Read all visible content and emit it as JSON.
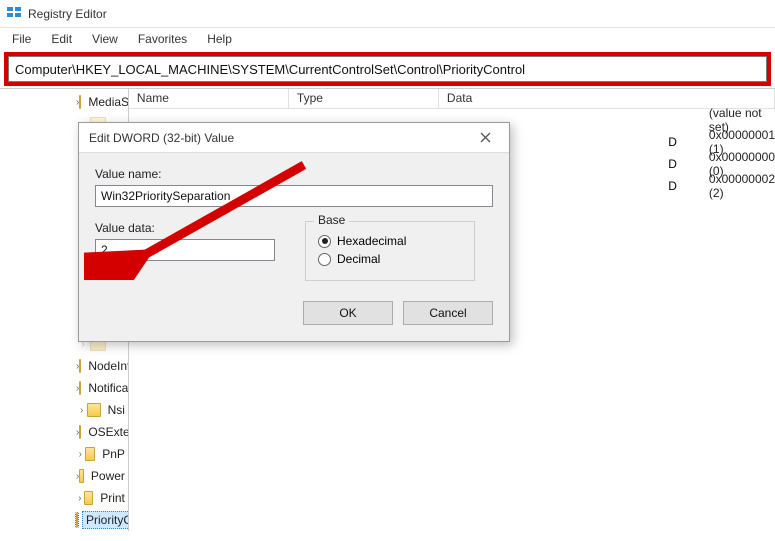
{
  "window": {
    "title": "Registry Editor"
  },
  "menu": {
    "file": "File",
    "edit": "Edit",
    "view": "View",
    "favorites": "Favorites",
    "help": "Help"
  },
  "address": {
    "value": "Computer\\HKEY_LOCAL_MACHINE\\SYSTEM\\CurrentControlSet\\Control\\PriorityControl"
  },
  "columns": {
    "name": "Name",
    "type": "Type",
    "data": "Data"
  },
  "values_list": {
    "row0": {
      "data": "(value not set)"
    },
    "row1": {
      "type_suffix": "D",
      "data": "0x00000001 (1)"
    },
    "row2": {
      "type_suffix": "D",
      "data": "0x00000000 (0)"
    },
    "row3": {
      "type_suffix": "D",
      "data": "0x00000002 (2)"
    }
  },
  "tree": {
    "mediasets": "MediaSets",
    "nodeinterfaces": "NodeInterfaces",
    "notifications": "Notifications",
    "nsi": "Nsi",
    "osext": "OSExtensionDatabase",
    "pnp": "PnP",
    "power": "Power",
    "print": "Print",
    "prioritycontrol": "PriorityControl"
  },
  "dialog": {
    "title": "Edit DWORD (32-bit) Value",
    "value_name_label": "Value name:",
    "value_name": "Win32PrioritySeparation",
    "value_data_label": "Value data:",
    "value_data": "2",
    "base_label": "Base",
    "hex": "Hexadecimal",
    "dec": "Decimal",
    "ok": "OK",
    "cancel": "Cancel"
  }
}
